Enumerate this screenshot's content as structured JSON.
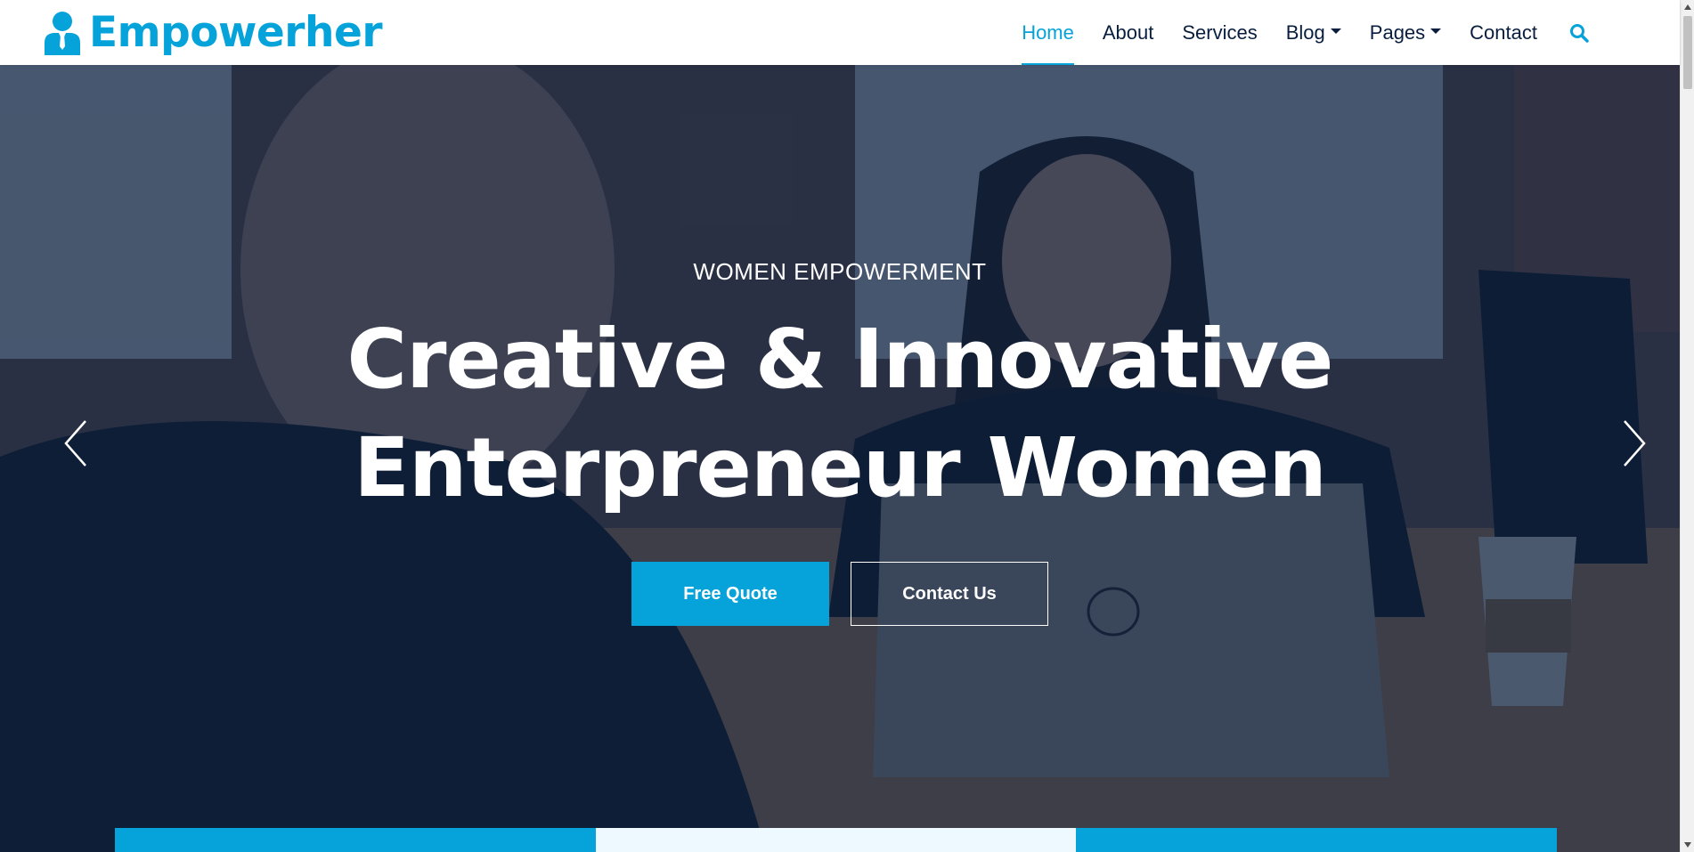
{
  "brand": {
    "name": "Empowerher",
    "icon": "user-tie-icon"
  },
  "nav": {
    "items": [
      {
        "label": "Home",
        "active": true
      },
      {
        "label": "About"
      },
      {
        "label": "Services"
      },
      {
        "label": "Blog",
        "dropdown": true
      },
      {
        "label": "Pages",
        "dropdown": true
      },
      {
        "label": "Contact"
      }
    ],
    "search_icon": "search-icon"
  },
  "hero": {
    "eyebrow": "Women Empowerment",
    "headline_line1": "Creative & Innovative",
    "headline_line2": "Enterpreneur Women",
    "primary_button": "Free Quote",
    "secondary_button": "Contact Us",
    "prev_icon": "chevron-left-icon",
    "next_icon": "chevron-right-icon"
  },
  "colors": {
    "primary": "#06A3DA",
    "dark": "#091E3E",
    "light": "#EEF9FF"
  }
}
